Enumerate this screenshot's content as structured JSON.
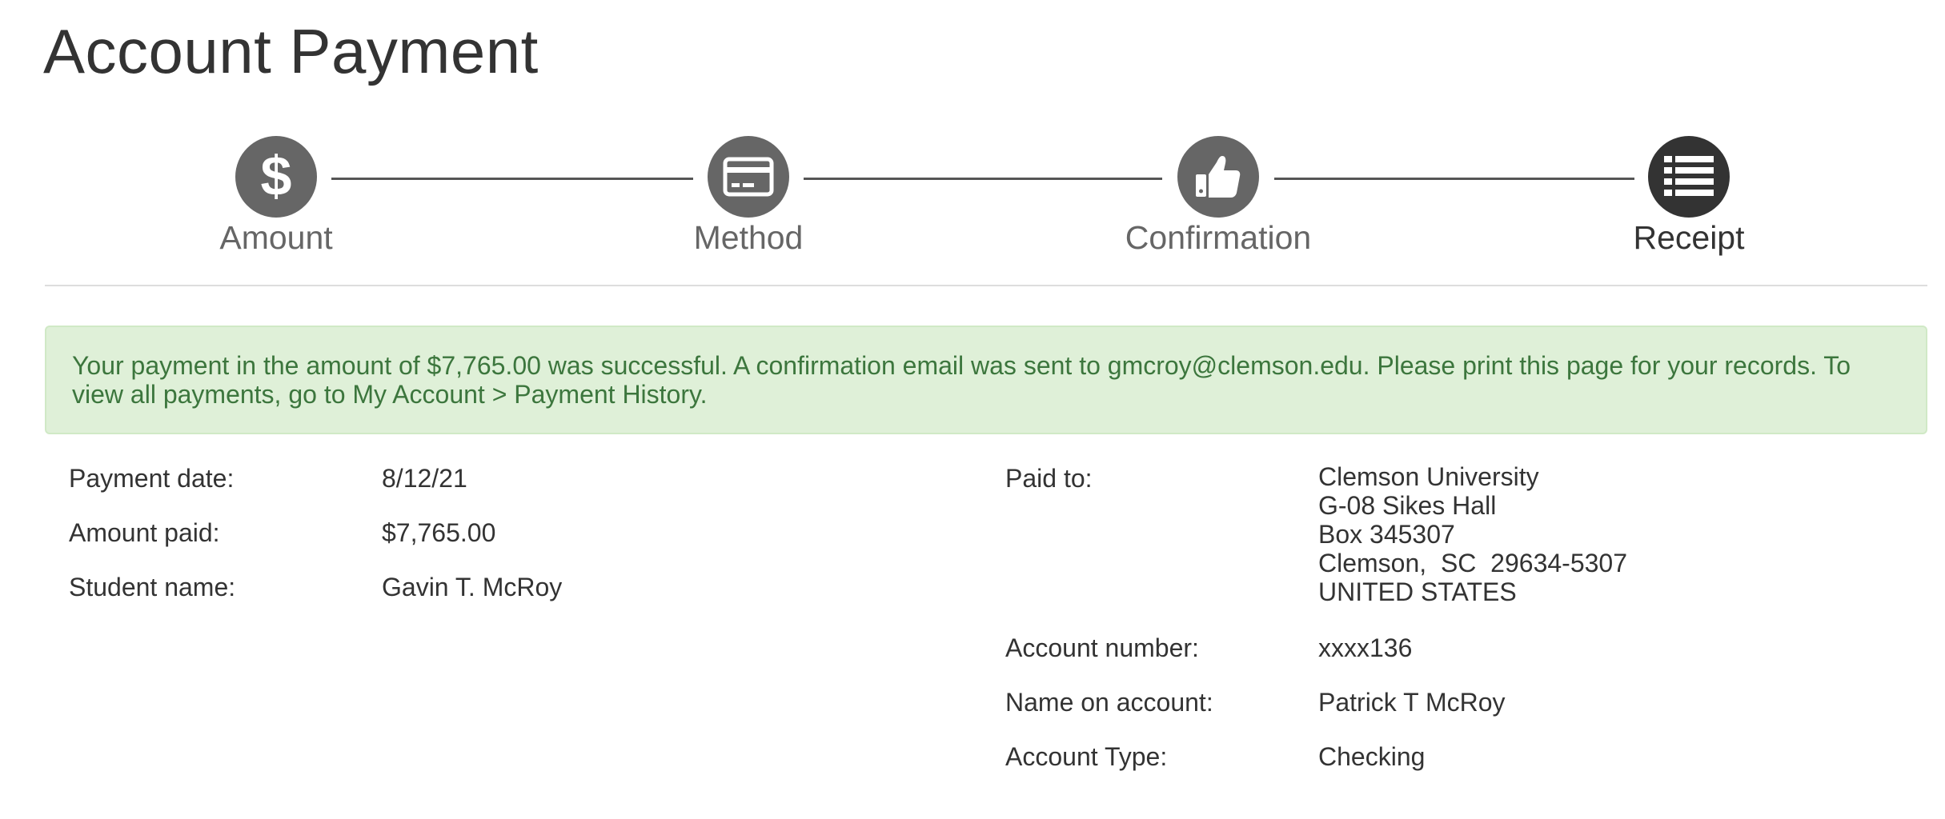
{
  "page": {
    "title": "Account Payment"
  },
  "stepper": {
    "steps": [
      {
        "label": "Amount",
        "icon": "dollar-icon",
        "active": false
      },
      {
        "label": "Method",
        "icon": "credit-card-icon",
        "active": false
      },
      {
        "label": "Confirmation",
        "icon": "thumbs-up-icon",
        "active": false
      },
      {
        "label": "Receipt",
        "icon": "list-icon",
        "active": true
      }
    ]
  },
  "alert": {
    "message": "Your payment in the amount of $7,765.00 was successful.  A confirmation email was sent to gmcroy@clemson.edu.  Please print this page for your records. To view all payments, go to My Account > Payment History."
  },
  "details": {
    "left": [
      {
        "label": "Payment date:",
        "value": "8/12/21"
      },
      {
        "label": "Amount paid:",
        "value": "$7,765.00"
      },
      {
        "label": "Student name:",
        "value": "Gavin T. McRoy"
      }
    ],
    "paid_to": {
      "label": "Paid to:",
      "lines": [
        "Clemson University",
        "G-08 Sikes Hall",
        "Box 345307",
        "Clemson,  SC  29634-5307",
        "UNITED STATES"
      ]
    },
    "right": [
      {
        "label": "Account number:",
        "value": "xxxx136"
      },
      {
        "label": "Name on account:",
        "value": "Patrick T McRoy"
      },
      {
        "label": "Account Type:",
        "value": "Checking"
      }
    ]
  },
  "colors": {
    "step_inactive": "#666666",
    "step_active": "#333333",
    "alert_bg": "#dff0d8",
    "alert_text": "#3c763d"
  }
}
